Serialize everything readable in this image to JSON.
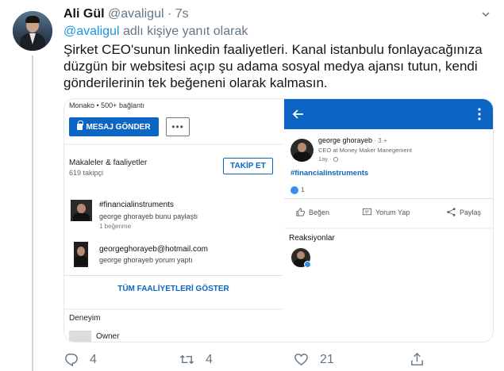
{
  "tweet": {
    "author_name": "Ali Gül",
    "handle": "@avaligul",
    "dot": "·",
    "time": "7s",
    "reply_mention": "@avaligul",
    "reply_suffix": " adlı kişiye yanıt olarak",
    "text": "Şirket CEO'sunun linkedin faaliyetleri. Kanal istanbulu fonlayacağınıza düzgün bir websitesi açıp şu adama sosyal medya ajansı tutun, kendi gönderilerinin tek beğeneni olarak kalmasın."
  },
  "left_shot": {
    "location": "Monako • 500+ bağlantı",
    "message_button": "MESAJ GÖNDER",
    "more_button": "•••",
    "section_title": "Makaleler & faaliyetler",
    "followers": "619 takipçi",
    "follow_button": "TAKİP ET",
    "activity1": {
      "title": "#financialinstruments",
      "sub": "george ghorayeb bunu paylaştı",
      "meta": "1 beğenme"
    },
    "activity2": {
      "title": "georgeghorayeb@hotmail.com",
      "sub": "george ghorayeb yorum yaptı"
    },
    "show_all": "TÜM FAALİYETLERİ GÖSTER",
    "experience_title": "Deneyim",
    "experience_role": "Owner"
  },
  "right_shot": {
    "name": "george ghorayeb",
    "degree": " · 3.+",
    "job_title": "CEO at Money Maker Manegement",
    "time": "1ay ·",
    "hashtag": "#financialinstruments",
    "like_count": "1",
    "like_action": "Beğen",
    "comment_action": "Yorum Yap",
    "share_action": "Paylaş",
    "reactions_title": "Reaksiyonlar"
  },
  "actions": {
    "reply_count": "4",
    "retweet_count": "4",
    "like_count": "21"
  },
  "colors": {
    "twitter_blue": "#1b95e0",
    "linkedin_blue": "#0a66c2",
    "muted": "#657786"
  }
}
